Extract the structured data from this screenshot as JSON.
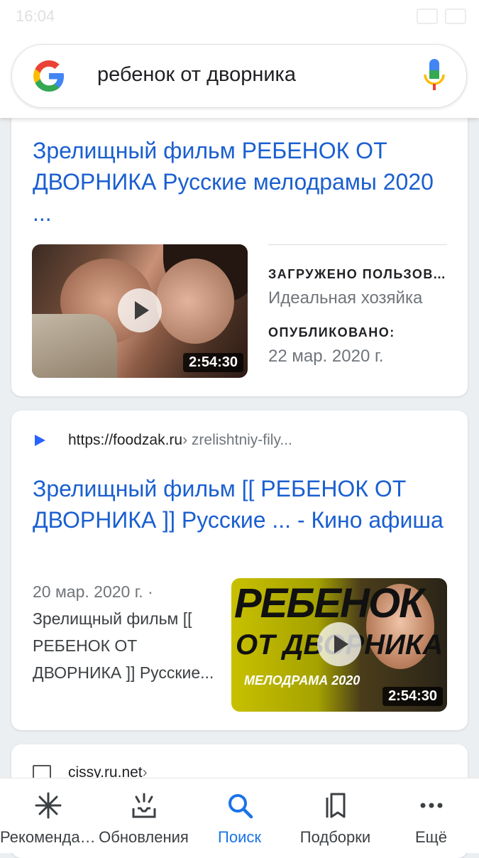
{
  "status_bar": {
    "time": "16:04"
  },
  "search": {
    "query": "ребенок от дворника"
  },
  "results": [
    {
      "title": "Зрелищный фильм РЕБЕНОК ОТ ДВОРНИКА Русские мелодрамы 2020 ...",
      "duration": "2:54:30",
      "uploaded_label": "ЗАГРУЖЕНО ПОЛЬЗОВАТЕЛЕМ",
      "uploaded_value": "Идеальная хозяйка",
      "published_label": "ОПУБЛИКОВАНО:",
      "published_value": "22 мар. 2020 г."
    },
    {
      "site_url": "https://foodzak.ru",
      "site_path": " › zrelishtniy-fily...",
      "title": "Зрелищный фильм [[ РЕБЕНОК ОТ ДВОРНИКА ]] Русские ... - Кино афиша",
      "date": "20 мар. 2020 г. · ",
      "snippet": "Зрелищный фильм [[ РЕБЕНОК ОТ ДВОРНИКА ]] Русские...",
      "duration": "2:54:30",
      "poster_title": "РЕБЕНОК",
      "poster_sub": "ОТ ДВОРНИКА",
      "poster_genre": "МЕЛОДРАМА 2020"
    },
    {
      "site_url": "cissy.ru.net",
      "site_path": " ›"
    }
  ],
  "bottom_nav": [
    {
      "label": "Рекомендации",
      "icon": "asterisk-icon"
    },
    {
      "label": "Обновления",
      "icon": "updates-icon"
    },
    {
      "label": "Поиск",
      "icon": "search-icon",
      "active": true
    },
    {
      "label": "Подборки",
      "icon": "collections-icon"
    },
    {
      "label": "Ещё",
      "icon": "more-icon"
    }
  ],
  "colors": {
    "link": "#1a5fd0",
    "active": "#1a73e8"
  }
}
